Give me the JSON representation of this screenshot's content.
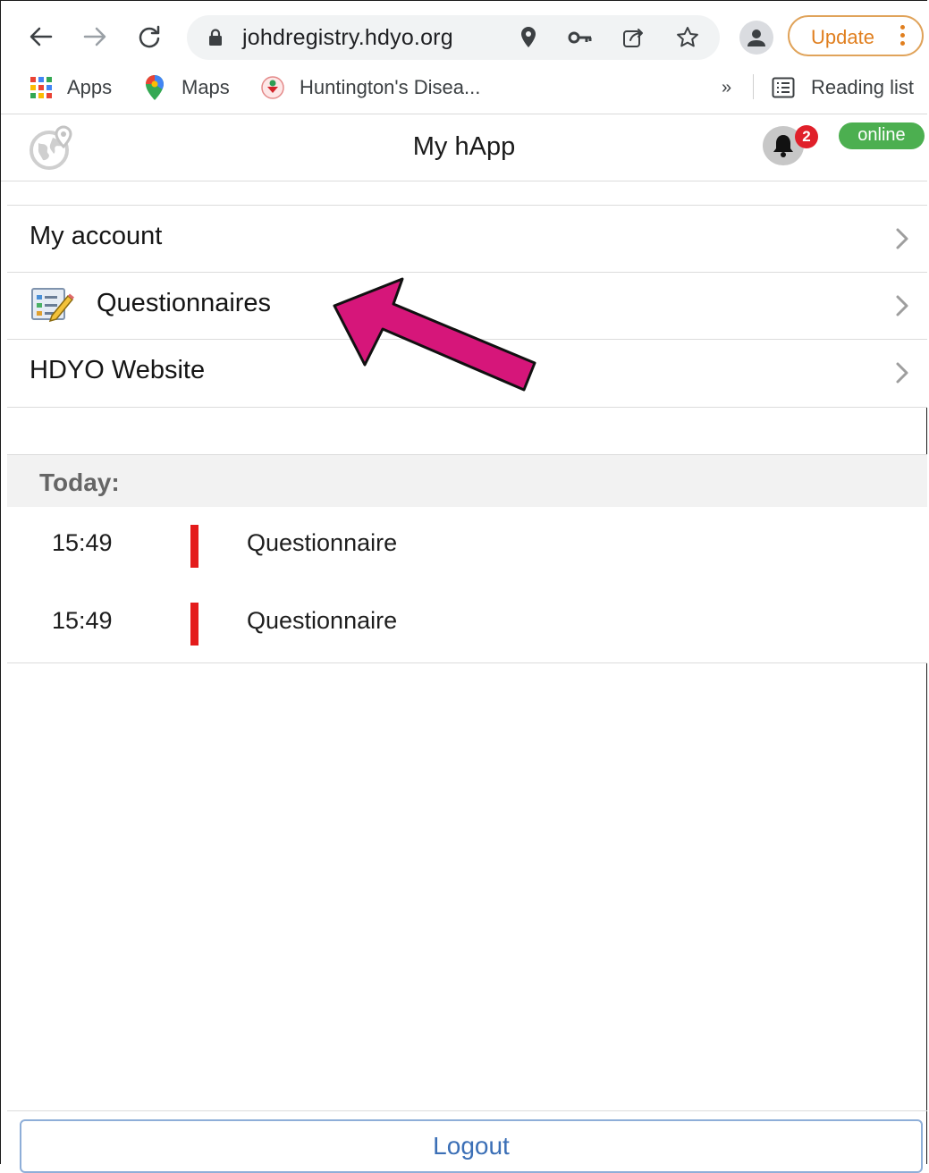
{
  "browser": {
    "url": "johdregistry.hdyo.org",
    "update_label": "Update",
    "bookmarks": [
      {
        "label": "Apps",
        "icon": "apps-grid-icon"
      },
      {
        "label": "Maps",
        "icon": "maps-pin-icon"
      },
      {
        "label": "Huntington's Disea...",
        "icon": "huntingtons-site-icon"
      }
    ],
    "overflow_label": "»",
    "reading_list_label": "Reading list"
  },
  "app": {
    "title": "My hApp",
    "notification_count": "2",
    "status": "online",
    "status_color": "#4caf50"
  },
  "menu": {
    "items": [
      {
        "label": "My account"
      },
      {
        "label": "Questionnaires",
        "icon": "questionnaire-icon"
      },
      {
        "label": "HDYO Website"
      }
    ]
  },
  "today": {
    "header": "Today:",
    "entries": [
      {
        "time": "15:49",
        "title": "Questionnaire",
        "marker_color": "#e41b1b"
      },
      {
        "time": "15:49",
        "title": "Questionnaire",
        "marker_color": "#e41b1b"
      }
    ]
  },
  "footer": {
    "logout_label": "Logout"
  },
  "annotation": {
    "arrow_color": "#d6167a"
  }
}
